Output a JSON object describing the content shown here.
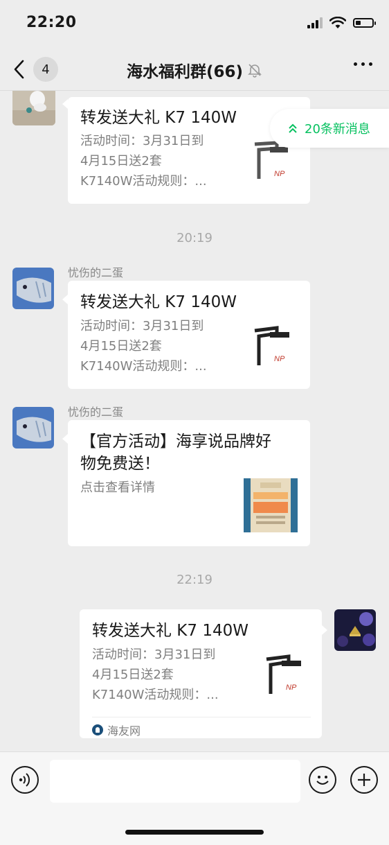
{
  "status_bar": {
    "time": "22:20",
    "icons": [
      "signal-icon",
      "wifi-icon",
      "battery-icon"
    ]
  },
  "nav": {
    "back_icon": "chevron-left-icon",
    "unread_count": "4",
    "title": "海水福利群(66)",
    "mute_icon": "bell-muted-icon",
    "more_icon": "more-dots-icon"
  },
  "new_messages": {
    "icon": "double-chevron-up-icon",
    "label": "20条新消息",
    "color": "#07c160"
  },
  "messages": [
    {
      "type": "link-card",
      "from": "incoming",
      "sender": "",
      "title": "转发送大礼 K7 140W",
      "desc_line1": "活动时间：3月31日到",
      "desc_line2": "4月15日送2套",
      "desc_line3": "K7140W活动规则：..."
    },
    {
      "type": "timestamp",
      "text": "20:19"
    },
    {
      "type": "link-card",
      "from": "incoming",
      "sender": "忧伤的二蛋",
      "title": "转发送大礼 K7 140W",
      "desc_line1": "活动时间：3月31日到",
      "desc_line2": "4月15日送2套",
      "desc_line3": "K7140W活动规则：..."
    },
    {
      "type": "link-card",
      "from": "incoming",
      "sender": "忧伤的二蛋",
      "title_line1": "【官方活动】海享说品牌好",
      "title_line2": "物免费送！",
      "desc_line1": "点击查看详情"
    },
    {
      "type": "timestamp",
      "text": "22:19"
    },
    {
      "type": "link-card",
      "from": "outgoing",
      "title": "转发送大礼 K7 140W",
      "desc_line1": "活动时间：3月31日到",
      "desc_line2": "4月15日送2套",
      "desc_line3": "K7140W活动规则：...",
      "source": "海友网"
    }
  ],
  "input_bar": {
    "voice_icon": "voice-icon",
    "emoji_icon": "emoji-icon",
    "plus_icon": "plus-icon",
    "placeholder": ""
  },
  "colors": {
    "background": "#ededed",
    "card": "#ffffff",
    "accent": "#07c160",
    "muted_text": "#7f7f7f"
  }
}
